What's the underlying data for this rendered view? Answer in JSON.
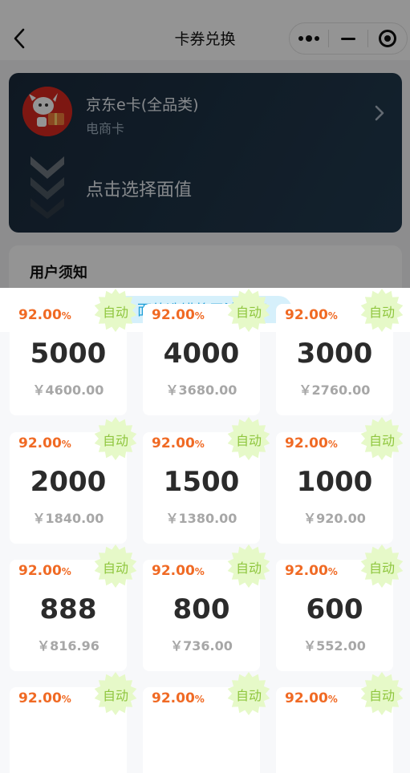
{
  "nav": {
    "title": "卡券兑换",
    "back_icon": "back-arrow-icon"
  },
  "capsule": {
    "more_icon": "more-dots-icon",
    "minimize_icon": "minimize-icon",
    "close_icon": "target-circle-icon"
  },
  "card": {
    "name": "京东e卡(全品类)",
    "type": "电商卡",
    "logo_icon": "jd-mascot-icon",
    "select_prompt": "点击选择面值",
    "accent": "#1e3346"
  },
  "notice": {
    "title": "用户须知"
  },
  "sheet": {
    "warning": "面值选错将无法结算",
    "warning_icon": "exclamation-icon",
    "close_icon": "close-icon",
    "colors": {
      "rate": "#f06a24",
      "badge": "#e6f9c8",
      "badge_text": "#8fc63e",
      "warning_bg": "#d6f0fb",
      "warning_text": "#1b9dd6"
    },
    "items": [
      {
        "rate": "92.00",
        "unit": "%",
        "value": "5000",
        "price": "￥4600.00",
        "badge": "自动"
      },
      {
        "rate": "92.00",
        "unit": "%",
        "value": "4000",
        "price": "￥3680.00",
        "badge": "自动"
      },
      {
        "rate": "92.00",
        "unit": "%",
        "value": "3000",
        "price": "￥2760.00",
        "badge": "自动"
      },
      {
        "rate": "92.00",
        "unit": "%",
        "value": "2000",
        "price": "￥1840.00",
        "badge": "自动"
      },
      {
        "rate": "92.00",
        "unit": "%",
        "value": "1500",
        "price": "￥1380.00",
        "badge": "自动"
      },
      {
        "rate": "92.00",
        "unit": "%",
        "value": "1000",
        "price": "￥920.00",
        "badge": "自动"
      },
      {
        "rate": "92.00",
        "unit": "%",
        "value": "888",
        "price": "￥816.96",
        "badge": "自动"
      },
      {
        "rate": "92.00",
        "unit": "%",
        "value": "800",
        "price": "￥736.00",
        "badge": "自动"
      },
      {
        "rate": "92.00",
        "unit": "%",
        "value": "600",
        "price": "￥552.00",
        "badge": "自动"
      },
      {
        "rate": "92.00",
        "unit": "%",
        "value": "",
        "price": "",
        "badge": "自动"
      },
      {
        "rate": "92.00",
        "unit": "%",
        "value": "",
        "price": "",
        "badge": "自动"
      },
      {
        "rate": "92.00",
        "unit": "%",
        "value": "",
        "price": "",
        "badge": "自动"
      }
    ]
  }
}
